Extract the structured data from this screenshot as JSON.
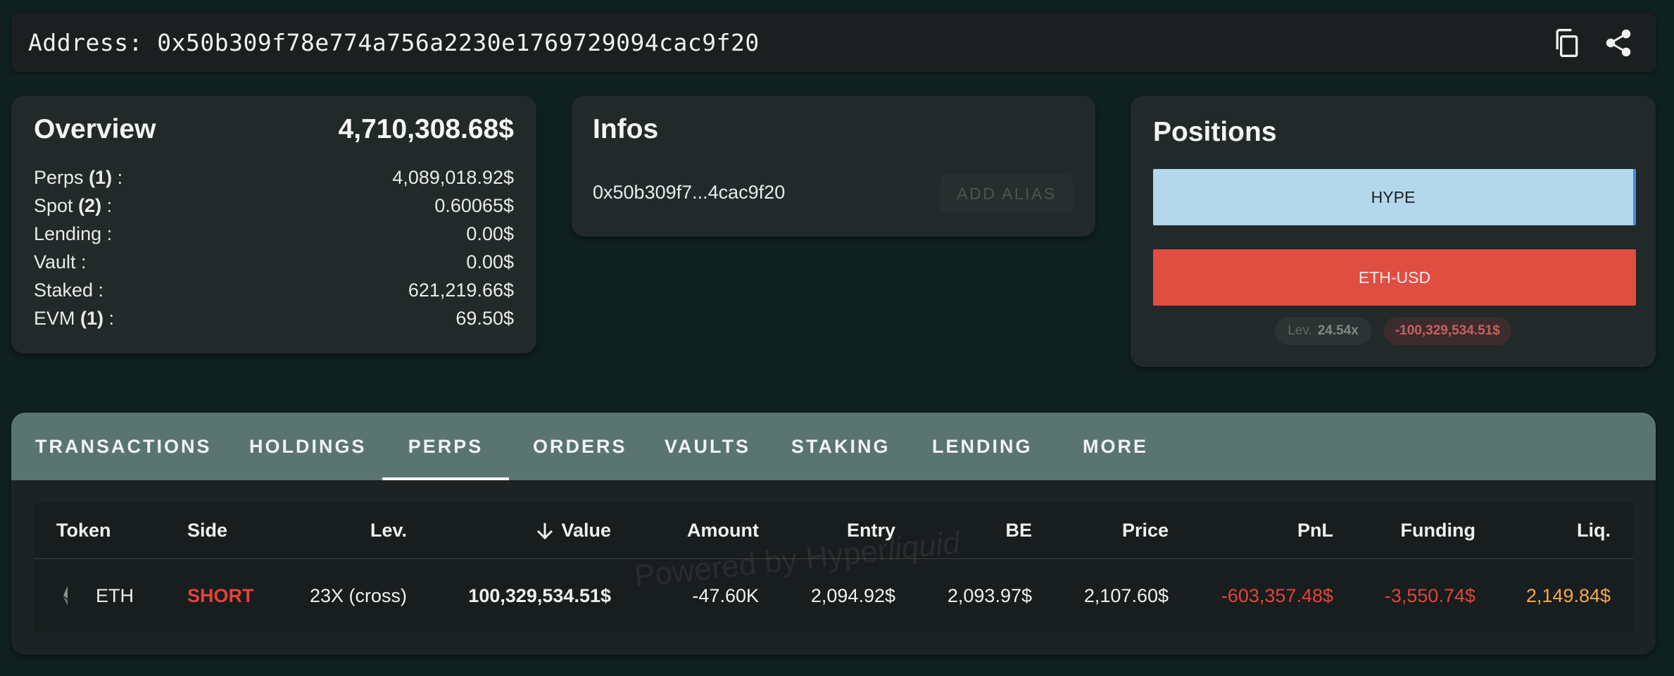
{
  "address_bar": {
    "label": "Address: 0x50b309f78e774a756a2230e1769729094cac9f20"
  },
  "overview": {
    "title": "Overview",
    "total": "4,710,308.68$",
    "rows": [
      {
        "label": "Perps",
        "count": "(1)",
        "suffix": " :",
        "value": "4,089,018.92$"
      },
      {
        "label": "Spot",
        "count": "(2)",
        "suffix": " :",
        "value": "0.60065$"
      },
      {
        "label": "Lending :",
        "count": "",
        "suffix": "",
        "value": "0.00$"
      },
      {
        "label": "Vault :",
        "count": "",
        "suffix": "",
        "value": "0.00$"
      },
      {
        "label": "Staked :",
        "count": "",
        "suffix": "",
        "value": "621,219.66$"
      },
      {
        "label": "EVM",
        "count": "(1)",
        "suffix": " :",
        "value": "69.50$"
      }
    ]
  },
  "infos": {
    "title": "Infos",
    "short_address": "0x50b309f7...4cac9f20",
    "add_alias_label": "ADD ALIAS"
  },
  "positions": {
    "title": "Positions",
    "items": [
      "HYPE",
      "ETH-USD"
    ],
    "lev_label": "Lev.",
    "lev_value": "24.54x",
    "pnl_badge": "-100,329,534.51$"
  },
  "tabs": [
    "TRANSACTIONS",
    "HOLDINGS",
    "PERPS",
    "ORDERS",
    "VAULTS",
    "STAKING",
    "LENDING",
    "MORE"
  ],
  "active_tab": "PERPS",
  "table": {
    "headers": {
      "token": "Token",
      "side": "Side",
      "lev": "Lev.",
      "value": "Value",
      "amount": "Amount",
      "entry": "Entry",
      "be": "BE",
      "price": "Price",
      "pnl": "PnL",
      "funding": "Funding",
      "liq": "Liq."
    },
    "rows": [
      {
        "token": "ETH",
        "side": "SHORT",
        "lev": "23X (cross)",
        "value": "100,329,534.51$",
        "amount": "-47.60K",
        "entry": "2,094.92$",
        "be": "2,093.97$",
        "price": "2,107.60$",
        "pnl": "-603,357.48$",
        "funding": "-3,550.74$",
        "liq": "2,149.84$"
      }
    ]
  },
  "watermark": {
    "prefix": "Powered by Hyper",
    "suffix": "liquid"
  },
  "colors": {
    "background": "#0f211e",
    "card": "#222929",
    "tab_bar": "#5a7570",
    "hype": "#b3d7eb",
    "eth": "#e04e41",
    "negative": "#e1443c",
    "liq": "#f0a94a"
  },
  "icons": [
    "copy-icon",
    "share-icon",
    "ethereum-icon",
    "arrow-down-icon"
  ]
}
